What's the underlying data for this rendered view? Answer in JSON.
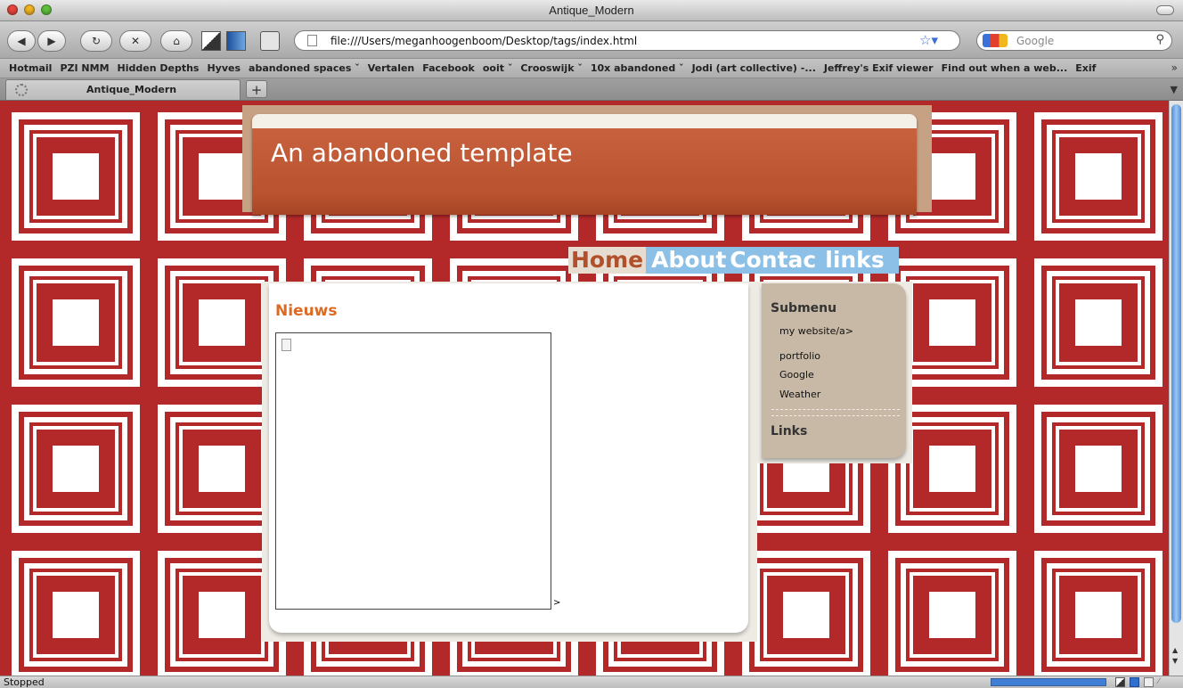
{
  "window": {
    "title": "Antique_Modern"
  },
  "toolbar": {
    "url": "file:///Users/meganhoogenboom/Desktop/tags/index.html",
    "search_placeholder": "Google"
  },
  "bookmarks": [
    "Hotmail",
    "PZI NMM",
    "Hidden Depths",
    "Hyves",
    "abandoned spaces ˇ",
    "Vertalen",
    "Facebook",
    "ooit ˇ",
    "Crooswijk ˇ",
    "10x abandoned ˇ",
    "Jodi (art collective) -...",
    "Jeffrey's Exif viewer",
    "Find out when a web...",
    "Exif"
  ],
  "tabs": [
    {
      "label": "Antique_Modern"
    }
  ],
  "page": {
    "header_title": "An abandoned template",
    "menu": {
      "home": "Home",
      "about": "About",
      "contact": "Contac",
      "links": "links"
    },
    "news_heading": "Nieuws",
    "stray_text": ">",
    "sidebar": {
      "heading": "Submenu",
      "items": [
        "my website/a>",
        "portfolio",
        "Google",
        "Weather"
      ],
      "links_heading": "Links"
    }
  },
  "status": {
    "text": "Stopped"
  },
  "colors": {
    "tile_red": "#b3292a",
    "banner_orange": "#c8613d",
    "news_orange": "#dc6a23",
    "sidebar_tan": "#c8b9a6",
    "menu_blue": "#8cc0e6"
  }
}
